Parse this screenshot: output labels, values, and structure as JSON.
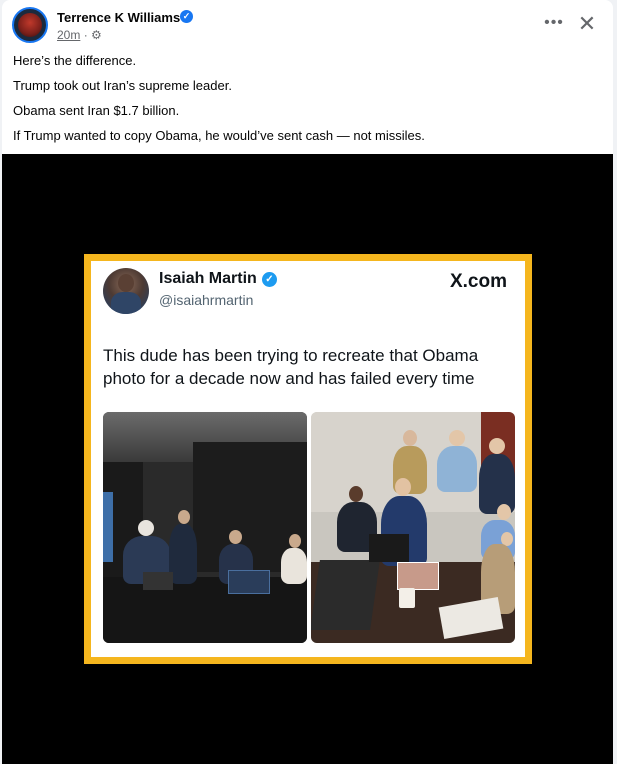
{
  "post": {
    "author": "Terrence K Williams",
    "verified_mark": "✓",
    "time": "20m",
    "separator": "·",
    "audience_icon": "globe-gear-icon",
    "audience_glyph": "⚙",
    "more_glyph": "•••",
    "close_glyph": "✕",
    "lines": [
      "Here’s the difference.",
      "Trump took out Iran’s supreme leader.",
      "Obama sent Iran $1.7 billion.",
      "If Trump wanted to copy Obama, he would’ve sent cash — not missiles."
    ]
  },
  "embedded_tweet": {
    "name": "Isaiah Martin",
    "verified_mark": "✓",
    "handle": "@isaiahrmartin",
    "site": "X.com",
    "body": "This dude has been trying to recreate that Obama photo for a decade now and has failed every time"
  },
  "colors": {
    "frame": "#f5b61e",
    "fb_blue": "#1877f2",
    "x_blue": "#1d9bf0"
  }
}
